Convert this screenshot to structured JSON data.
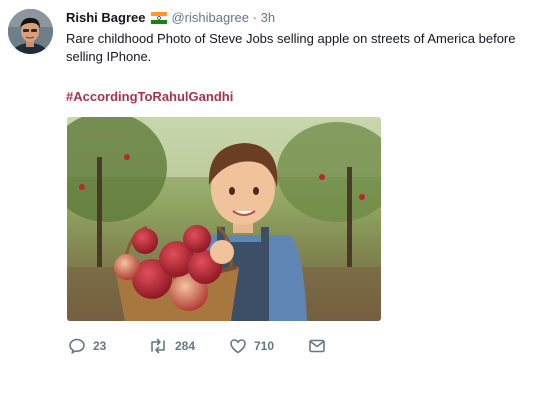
{
  "tweet": {
    "name": "Rishi Bagree",
    "handle": "@rishibagree",
    "separator": "·",
    "time": "3h",
    "text": "Rare childhood Photo of Steve Jobs selling apple on streets of America before selling IPhone.",
    "hashtag": "#AccordingToRahulGandhi",
    "replies": "23",
    "retweets": "284",
    "likes": "710"
  },
  "colors": {
    "hashtag": "#a8324d",
    "muted": "#657786",
    "text": "#14171a"
  },
  "icons": {
    "flag": "india-flag-icon",
    "reply": "reply-icon",
    "retweet": "retweet-icon",
    "like": "heart-icon",
    "dm": "envelope-icon"
  }
}
